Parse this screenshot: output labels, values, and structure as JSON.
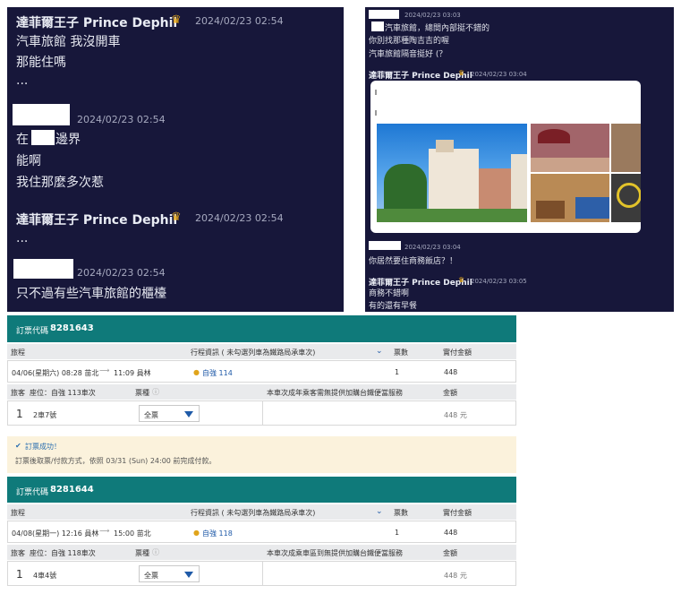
{
  "chat1": {
    "msgs": [
      {
        "name": "達菲爾王子 Prince Dephil",
        "time": "2024/02/23 02:54",
        "lines": [
          "汽車旅館 我沒開車",
          "那能住嗎",
          "..."
        ]
      },
      {
        "name": "",
        "time": "2024/02/23 02:54",
        "lines": [
          "在",
          "邊界",
          "能啊",
          "我住那麼多次惹"
        ]
      },
      {
        "name": "達菲爾王子 Prince Dephil",
        "time": "2024/02/23 02:54",
        "lines": [
          "..."
        ]
      },
      {
        "name": "",
        "time": "2024/02/23 02:54",
        "lines": [
          "只不過有些汽車旅館的櫃檯"
        ]
      }
    ]
  },
  "chat2": {
    "top": {
      "time": "2024/02/23 03:03",
      "lines": [
        "汽車旅館，總間內部挺不錯的",
        "你別找那種陶吉吉的喔",
        "汽車旅館隔音挺好 (？"
      ]
    },
    "m1": {
      "name": "達菲爾王子 Prince Dephil",
      "time": "2024/02/23 03:04"
    },
    "m2": {
      "time": "2024/02/23 03:04",
      "lines": [
        "你居然要住商務飯店？！"
      ]
    },
    "m3": {
      "name": "達菲爾王子 Prince Dephil",
      "time": "2024/02/23 03:05",
      "lines": [
        "商務不錯啊",
        "有的還有早餐"
      ]
    }
  },
  "orders": [
    {
      "code_label": "訂票代碼",
      "code": "8281643",
      "h_trip": "旅程",
      "h_info": "行程資訊 ( 未勾選列車為鐵路局承車次)",
      "h_qty": "票數",
      "h_pay": "實付金額",
      "trip": "04/06(星期六) 08:28 苗北",
      "arrow": "⟶",
      "arr": "11:09 員林",
      "train": "自強 114",
      "qty": "1",
      "pay": "448",
      "h_no": "旅客",
      "h_seat": "座位：自強 113車次",
      "h_type": "票種",
      "h_note": "本車次成年乘客需無提供加購台鐵便當服務",
      "h_amt": "金額",
      "no": "1",
      "seat": "2車7號",
      "type": "全票",
      "amt": "448 元"
    },
    {
      "code_label": "訂票代碼",
      "code": "8281644",
      "h_trip": "旅程",
      "h_info": "行程資訊 ( 未勾選列車為鐵路局承車次)",
      "h_qty": "票數",
      "h_pay": "實付金額",
      "trip": "04/08(星期一) 12:16 員林",
      "arrow": "⟶",
      "arr": "15:00 苗北",
      "train": "自強 118",
      "qty": "1",
      "pay": "448",
      "h_no": "旅客",
      "h_seat": "座位：自強 118車次",
      "h_type": "票種",
      "h_note": "本車次成乘車區到無提供加購台鐵便當服務",
      "h_amt": "金額",
      "no": "1",
      "seat": "4車4號",
      "type": "全票",
      "amt": "448 元"
    }
  ],
  "success": {
    "title": "訂票成功！",
    "text": "訂票後取票/付款方式，依照 03/31 (Sun) 24:00 前完成付款。"
  },
  "colors": {
    "chat_bg": "#17173a",
    "teal": "#0f7a7a",
    "crown": "#e5a719"
  }
}
